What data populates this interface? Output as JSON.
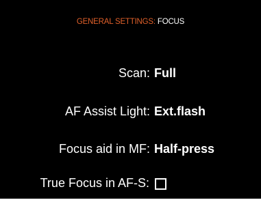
{
  "header": {
    "section": "GENERAL SETTINGS:",
    "page": "FOCUS"
  },
  "settings": {
    "scan": {
      "label": "Scan:",
      "value": "Full"
    },
    "af_assist": {
      "label": "AF Assist Light:",
      "value": "Ext.flash"
    },
    "focus_aid": {
      "label": "Focus aid in MF:",
      "value": "Half-press"
    },
    "true_focus": {
      "label": "True Focus in AF-S:",
      "checked": false
    }
  },
  "colors": {
    "background": "#000000",
    "text": "#ffffff",
    "accent": "#e0602a"
  }
}
